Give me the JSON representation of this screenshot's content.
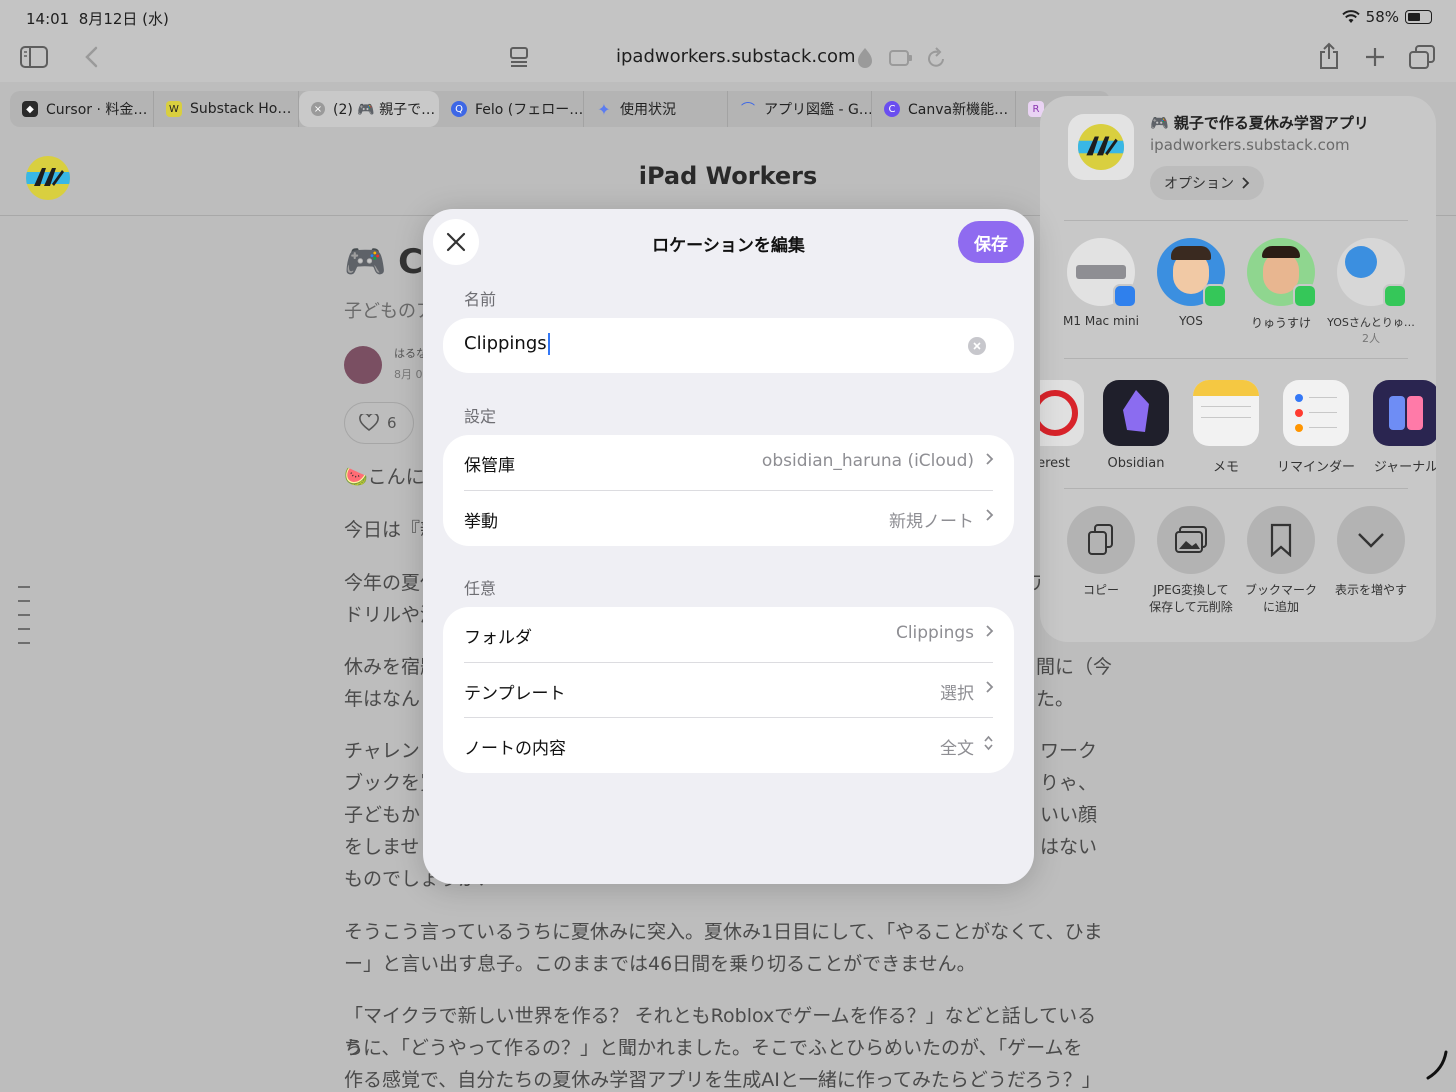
{
  "status_bar": {
    "time": "14:01",
    "date": "8月12日 (水)",
    "battery": "58%",
    "battery_level": 0.58
  },
  "toolbar": {
    "url": "ipadworkers.substack.com"
  },
  "tabs": [
    {
      "label": "Cursor · 料金…"
    },
    {
      "label": "Substack Ho…"
    },
    {
      "label": "(2) 🎮 親子で…"
    },
    {
      "label": "Felo (フェロー…"
    },
    {
      "label": "使用状況"
    },
    {
      "label": "アプリ図鑑 - G…"
    },
    {
      "label": "Canva新機能…"
    },
    {
      "label": "R"
    }
  ],
  "page": {
    "site_title": "iPad Workers",
    "article_title_fragment": "🎮 Ch",
    "subtitle_fragment": "子どものア",
    "author_fragment": "はるな",
    "date_fragment": "8月 0",
    "likes": "6",
    "p1": "🍉こんに",
    "p2": "今日は『親",
    "p3a": "今年の夏休",
    "p3b": "ドリルや漢",
    "p3r": "ア",
    "p4a": "休みを宿題",
    "p4a_r": "間に（今",
    "p4b": "年はなん",
    "p4b_r": "た。",
    "p5a": "チャレン",
    "p5a_r": "ワーク",
    "p5b": "ブックを買",
    "p5b_r": "りゃ、",
    "p5c": "子どもか",
    "p5c_r": "いい顔",
    "p5d": "をしませ",
    "p5d_r": "はない",
    "p5e": "ものでしょうか？",
    "p6a": "そうこう言っているうちに夏休みに突入。夏休み1日目にして、「やることがなくて、ひま",
    "p6b": "ー」と言い出す息子。このままでは46日間を乗り切ることができません。",
    "p7a": "「マイクラで新しい世界を作る？ それともRobloxでゲームを作る？」などと話しているう",
    "p7b": "ちに、「どうやって作るの？」と聞かれました。そこでふとひらめいたのが、「ゲームを",
    "p7c": "作る感覚で、自分たちの夏休み学習アプリを生成AIと一緒に作ってみたらどうだろう？」と"
  },
  "share_sheet": {
    "title": "🎮 親子で作る夏休み学習アプリ",
    "subtitle": "ipadworkers.substack.com",
    "options_label": "オプション",
    "people": [
      {
        "name": "M1 Mac mini",
        "note": ""
      },
      {
        "name": "YOS",
        "note": ""
      },
      {
        "name": "りゅうすけ",
        "note": ""
      },
      {
        "name": "YOSさんとりゅ…",
        "note": "2人"
      }
    ],
    "apps": [
      {
        "name": "terest"
      },
      {
        "name": "Obsidian"
      },
      {
        "name": "メモ"
      },
      {
        "name": "リマインダー"
      },
      {
        "name": "ジャーナル"
      }
    ],
    "actions": [
      {
        "line1": "コピー",
        "line2": ""
      },
      {
        "line1": "JPEG変換して",
        "line2": "保存して元削除"
      },
      {
        "line1": "ブックマーク",
        "line2": "に追加"
      },
      {
        "line1": "表示を増やす",
        "line2": ""
      }
    ]
  },
  "modal": {
    "title": "ロケーションを編集",
    "save_label": "保存",
    "name_section": "名前",
    "name_value": "Clippings",
    "settings_section": "設定",
    "vault_label": "保管庫",
    "vault_value": "obsidian_haruna (iCloud)",
    "behavior_label": "挙動",
    "behavior_value": "新規ノート",
    "optional_section": "任意",
    "folder_label": "フォルダ",
    "folder_value": "Clippings",
    "template_label": "テンプレート",
    "template_value": "選択",
    "content_label": "ノートの内容",
    "content_value": "全文"
  },
  "colors": {
    "accent": "#8f6bf0",
    "message_green": "#35c759"
  }
}
